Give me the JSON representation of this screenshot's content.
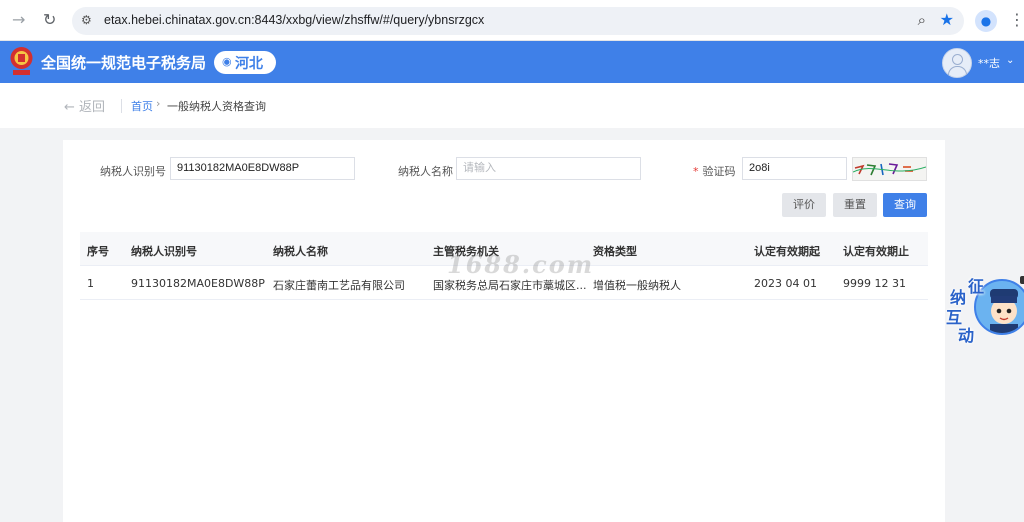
{
  "browser": {
    "url": "etax.hebei.chinatax.gov.cn:8443/xxbg/view/zhsffw/#/query/ybnsrzgcx",
    "icons": [
      "forward-icon",
      "reload-icon",
      "site-info-icon",
      "zoom-icon",
      "star-icon",
      "profile-icon",
      "menu-icon"
    ]
  },
  "header": {
    "title": "全国统一规范电子税务局",
    "region": "河北",
    "username": "**志",
    "colors": {
      "brand": "#3f80e8"
    }
  },
  "breadcrumb": {
    "back_label": "返回",
    "home": "首页",
    "current": "一般纳税人资格查询"
  },
  "form": {
    "taxpayer_id": {
      "label": "纳税人识别号",
      "value": "91130182MA0E8DW88P"
    },
    "taxpayer_name": {
      "label": "纳税人名称",
      "placeholder": "请输入"
    },
    "captcha": {
      "label": "验证码",
      "value": "2o8i"
    },
    "buttons": {
      "evaluate": "评价",
      "reset": "重置",
      "query": "查询"
    }
  },
  "table": {
    "columns": [
      "序号",
      "纳税人识别号",
      "纳税人名称",
      "主管税务机关",
      "资格类型",
      "认定有效期起",
      "认定有效期止"
    ],
    "rows": [
      [
        "1",
        "91130182MA0E8DW88P",
        "石家庄蕾南工艺品有限公司",
        "国家税务总局石家庄市藁城区...",
        "增值税一般纳税人",
        "2023 04 01",
        "9999 12 31"
      ]
    ]
  },
  "watermark": "1688.com",
  "float_widget": {
    "chars": [
      "征",
      "纳",
      "互",
      "动"
    ]
  }
}
